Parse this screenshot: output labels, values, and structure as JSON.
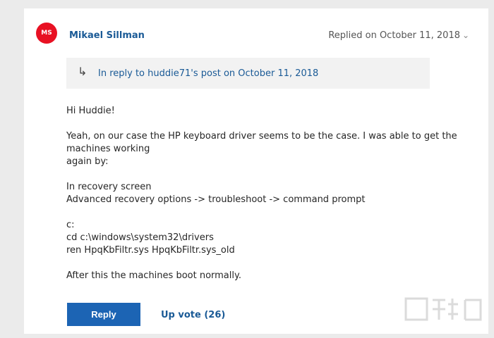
{
  "post": {
    "avatar_initials": "MS",
    "author": "Mikael Sillman",
    "replied_on": "Replied on October 11, 2018",
    "reply_ref": {
      "arrow": "↳",
      "text": "In reply to huddie71's post on October 11, 2018"
    },
    "body": {
      "greeting": "Hi Huddie!",
      "line1": "Yeah, on our case the HP keyboard driver seems to be the case. I was able to get the machines working",
      "line2": "again by:",
      "step1": "In recovery screen",
      "step2": "Advanced recovery options -> troubleshoot -> command prompt",
      "cmd1": "c:",
      "cmd2": "cd c:\\windows\\system32\\drivers",
      "cmd3": "ren HpqKbFiltr.sys HpqKbFiltr.sys_old",
      "closing": "After this the machines boot normally."
    },
    "actions": {
      "reply_label": "Reply",
      "upvote_label": "Up vote (26)"
    }
  },
  "colors": {
    "accent": "#1c64b4",
    "link": "#1a5a96",
    "avatar": "#e81123"
  },
  "icons": {
    "reply_arrow": "reply-arrow-icon",
    "chevron": "chevron-down-icon"
  }
}
